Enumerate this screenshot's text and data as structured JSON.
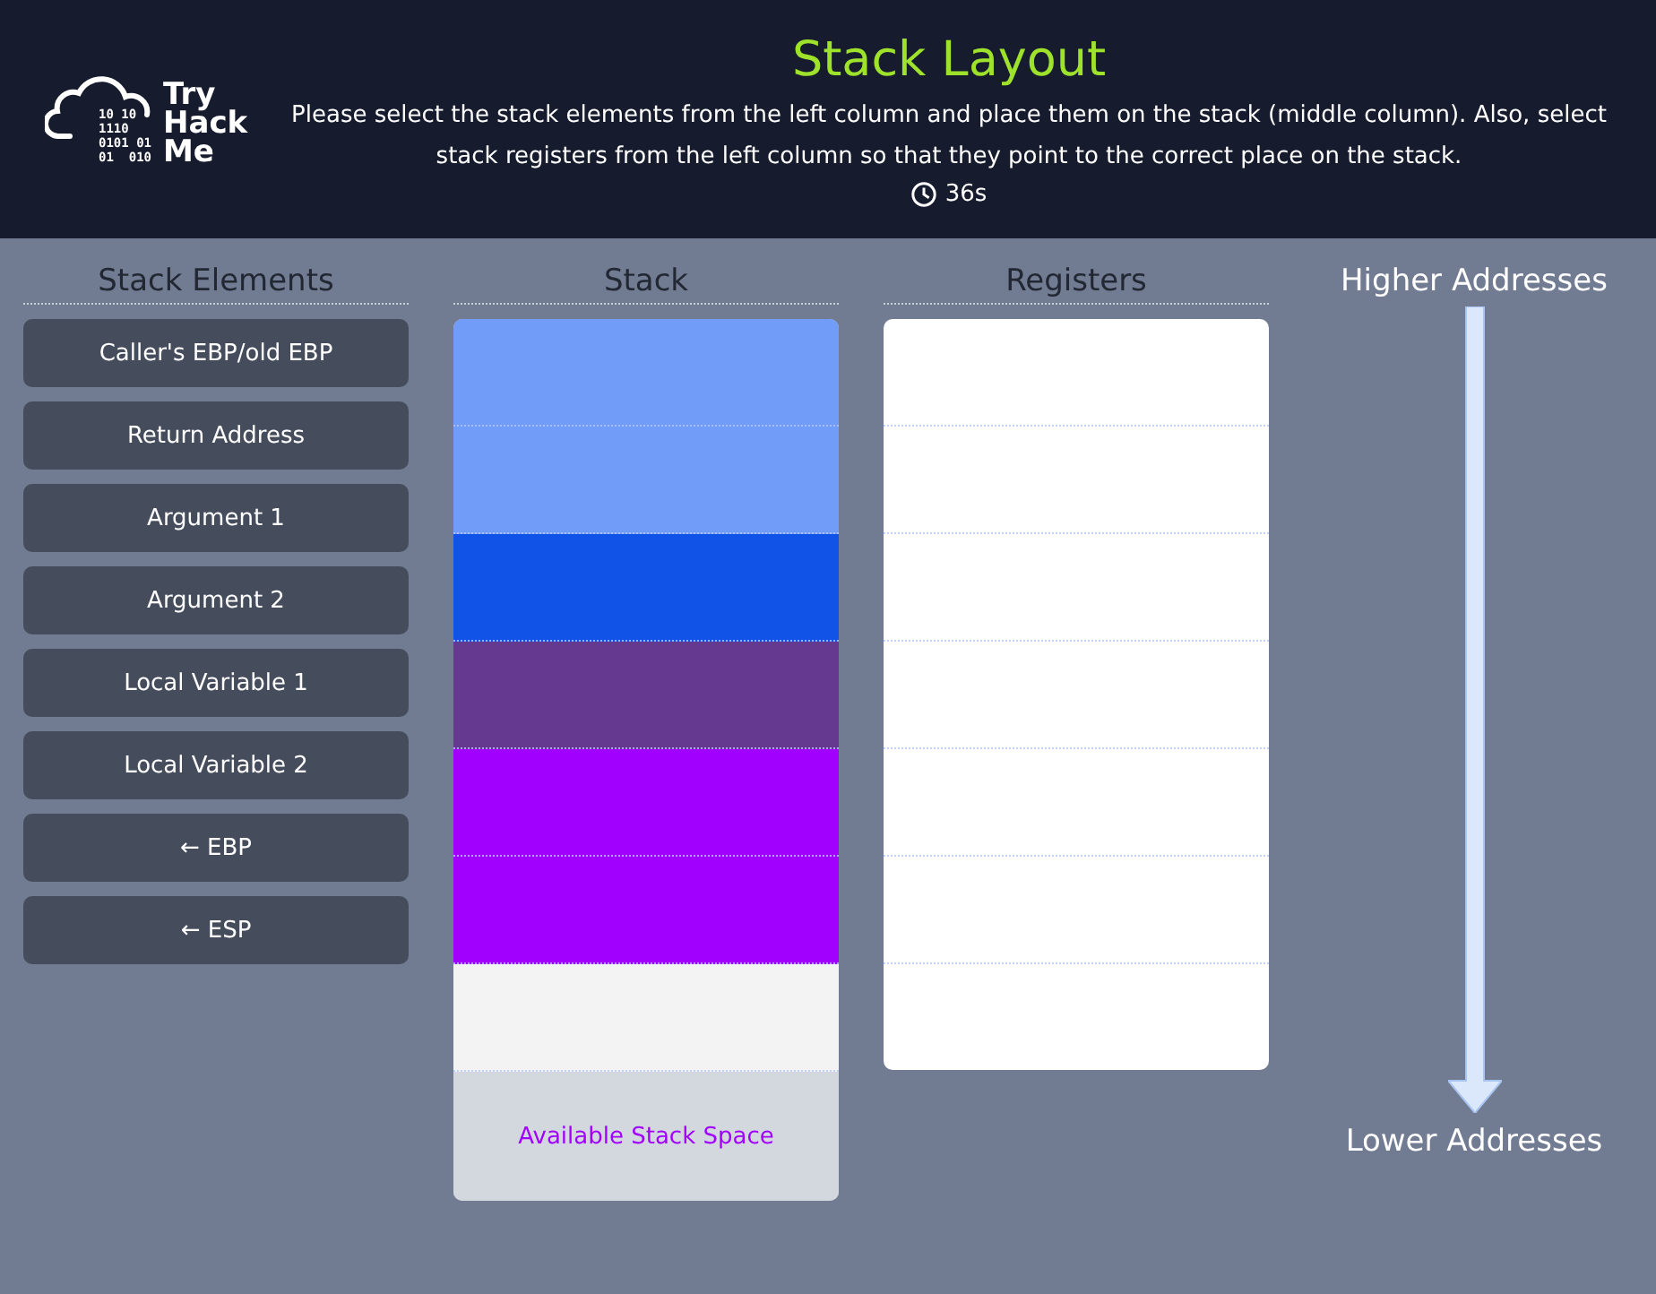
{
  "header": {
    "logo": {
      "binary": [
        "10 10",
        "1110",
        "0101 01",
        "01  010"
      ],
      "words": [
        "Try",
        "Hack",
        "Me"
      ]
    },
    "title": "Stack Layout",
    "description": [
      "Please select the stack elements from the left column and place them on the stack (middle column). Also, select",
      "stack registers from the left column so that they point to the correct place on the stack."
    ],
    "timer": "36s"
  },
  "elements": {
    "heading": "Stack Elements",
    "items": [
      {
        "label": "Caller's EBP/old EBP"
      },
      {
        "label": "Return Address"
      },
      {
        "label": "Argument 1"
      },
      {
        "label": "Argument 2"
      },
      {
        "label": "Local Variable 1"
      },
      {
        "label": "Local Variable 2"
      },
      {
        "label": "← EBP"
      },
      {
        "label": "← ESP"
      }
    ]
  },
  "stack": {
    "heading": "Stack",
    "slots": [
      {
        "color": "#719cf7"
      },
      {
        "color": "#719cf7"
      },
      {
        "color": "#1053e6"
      },
      {
        "color": "#65398f"
      },
      {
        "color": "#a100ff"
      },
      {
        "color": "#a100ff"
      },
      {
        "color": "#f3f3f3"
      }
    ],
    "free_space": "Available Stack Space"
  },
  "registers": {
    "heading": "Registers"
  },
  "direction": {
    "top": "Higher Addresses",
    "bottom": "Lower Addresses"
  }
}
